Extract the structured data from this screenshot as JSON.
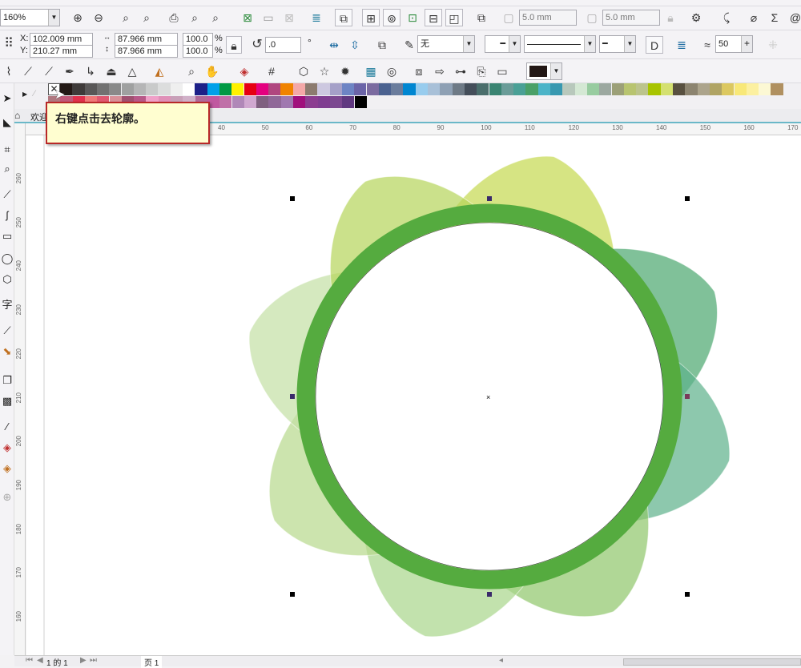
{
  "toolbar": {
    "zoom_value": "160%"
  },
  "property_bar": {
    "x_label": "X:",
    "x_value": "102.009 mm",
    "y_label": "Y:",
    "y_value": "210.27 mm",
    "width_value": "87.966 mm",
    "height_value": "87.966 mm",
    "scale_w": "100.0",
    "scale_h": "100.0",
    "percent": "%",
    "rotation_value": ".0",
    "degree": "°",
    "outline_width": "无",
    "nib_value": "50",
    "offset_x": "5.0 mm",
    "offset_y": "5.0 mm"
  },
  "fill_color": "#231815",
  "palette": {
    "row1": [
      "#231815",
      "#3e3a39",
      "#595757",
      "#727171",
      "#898989",
      "#9fa0a0",
      "#b5b5b6",
      "#c9caca",
      "#dcdddd",
      "#efefef",
      "#ffffff",
      "#1d2088",
      "#00a0e9",
      "#009944",
      "#fff100",
      "#e60012",
      "#e4007f",
      "#b0467f",
      "#f08300",
      "#f4a8a8",
      "#8c7b6f",
      "#cdc8e0",
      "#a5a0c8",
      "#6d84c4",
      "#6b64a8",
      "#7b6ba0",
      "#4b6290",
      "#6a7c9c",
      "#0086d1",
      "#98ccee",
      "#a8c0d8",
      "#8ea0b4",
      "#6e7a86",
      "#444e5a",
      "#4a6e6c",
      "#3a8472",
      "#6a9c98",
      "#4aa096",
      "#4aa068",
      "#4cb4c8",
      "#3898b0",
      "#b8c8bc",
      "#d4e8d4",
      "#98cca0",
      "#9ca8a0",
      "#9ca078",
      "#b8c470",
      "#bcc48c",
      "#a8c400",
      "#d4e070",
      "#585040",
      "#8c8470",
      "#aca48c",
      "#b0a464",
      "#dcc860",
      "#f8e878",
      "#fcf0a0",
      "#fcf8d4",
      "#b09060"
    ],
    "row2": [
      "#b07880",
      "#c05878",
      "#e0304c",
      "#f07878",
      "#e05870",
      "#d89098",
      "#a05070",
      "#b85888",
      "#f0a0c8",
      "#e090b8",
      "#c8a0b8",
      "#d0b0c8",
      "#b06898",
      "#c058a0",
      "#c070a8",
      "#b088b8",
      "#d0a8d0",
      "#806080",
      "#906898",
      "#a078b0",
      "#a0107c",
      "#8c3c90",
      "#803c90",
      "#7c4890",
      "#603880",
      "#000000"
    ],
    "no_color_label": "无"
  },
  "tabs": {
    "welcome": "欢迎"
  },
  "tooltip": {
    "text": "右键点击去轮廓。"
  },
  "ruler": {
    "h_ticks": [
      "40",
      "50",
      "60",
      "70",
      "80",
      "90",
      "100",
      "110",
      "120",
      "130",
      "140",
      "150",
      "160",
      "170"
    ],
    "v_ticks": [
      "260",
      "250",
      "240",
      "230",
      "220",
      "210",
      "200",
      "190",
      "180",
      "170",
      "160"
    ],
    "unit": "毫米"
  },
  "drawing": {
    "ring_color": "#55ab3f",
    "petal_colors": [
      "#c5d94f",
      "#4aa66e",
      "#5cb08a",
      "#8fc66a",
      "#a8d68a",
      "#b7d98c",
      "#c3e0a4",
      "#b5d45a"
    ]
  },
  "status": {
    "page_count": "1 的 1",
    "page_tab": "页 1"
  }
}
